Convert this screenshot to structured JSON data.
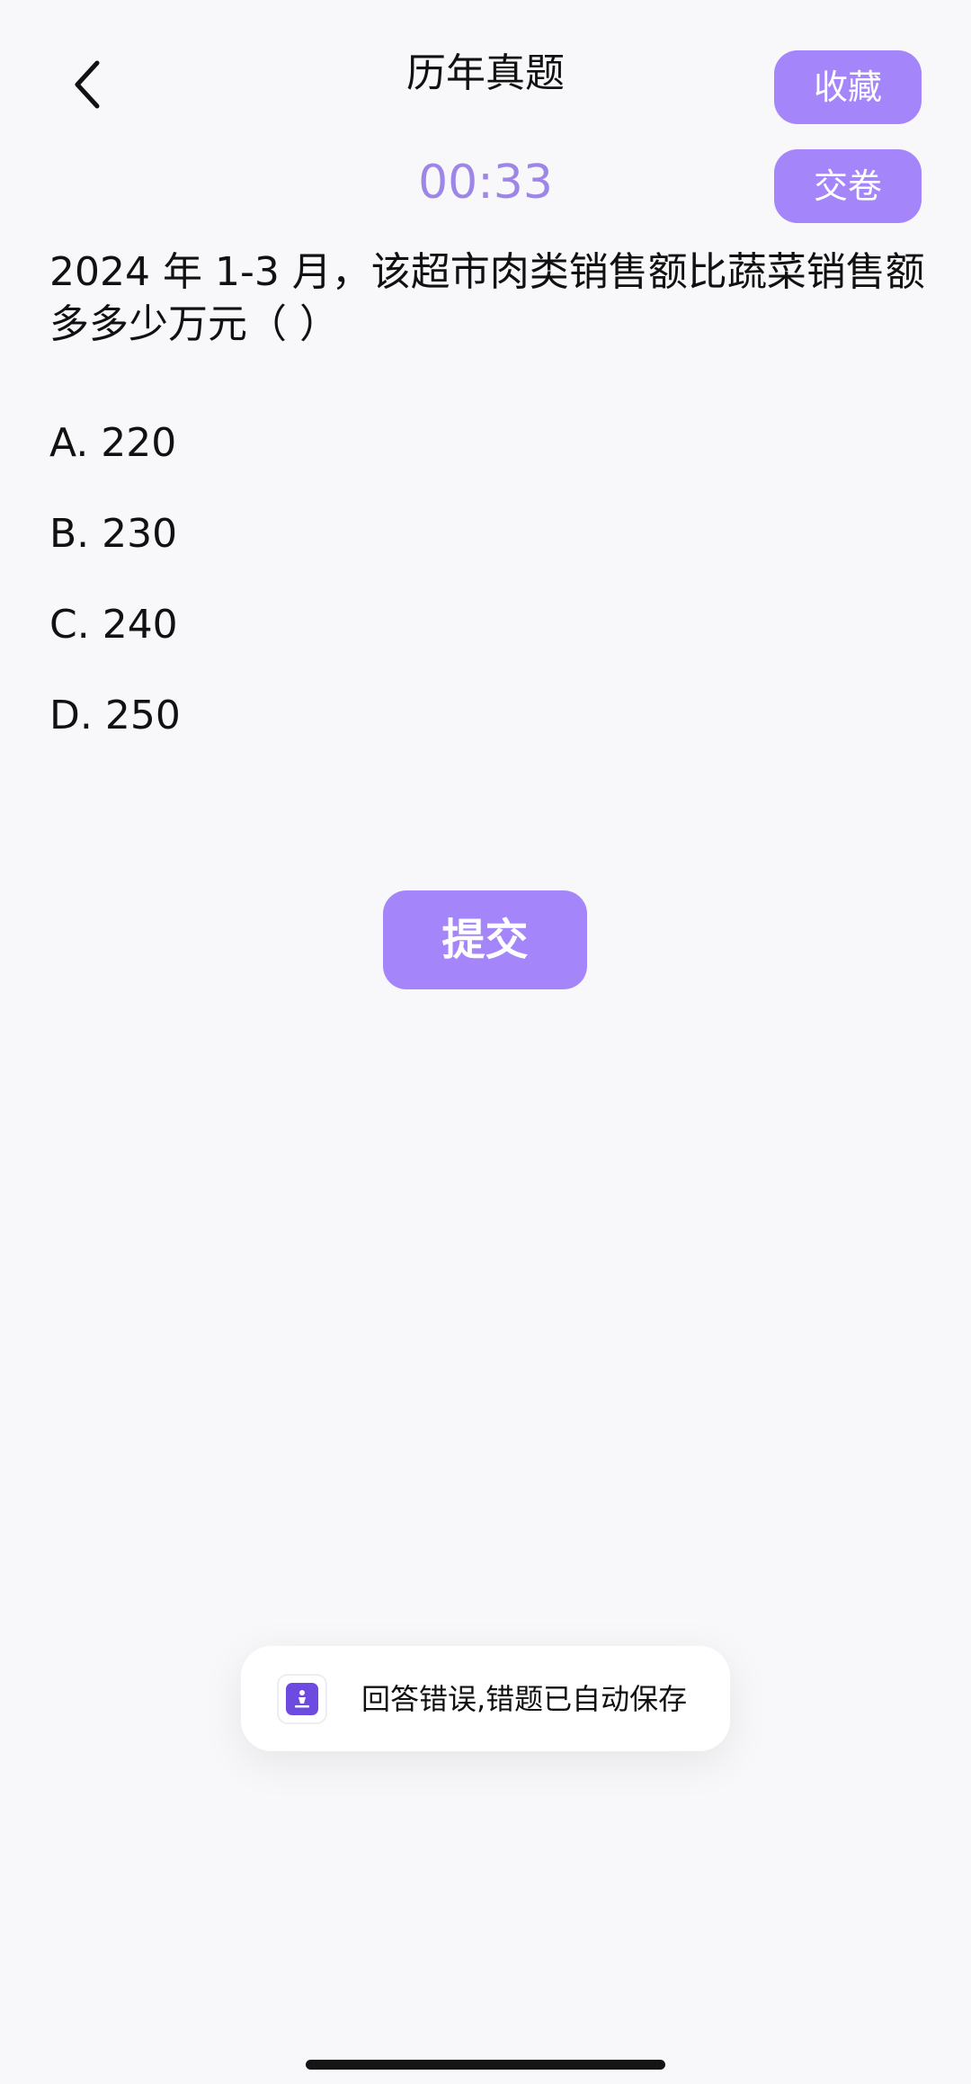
{
  "header": {
    "title": "历年真题",
    "back_icon": "chevron-left-icon",
    "favorite_label": "收藏",
    "submit_paper_label": "交卷"
  },
  "timer": {
    "value": "00:33"
  },
  "question": {
    "text": "2024 年 1-3 月，该超市肉类销售额比蔬菜销售额多多少万元（ ）",
    "options": [
      {
        "label": "A. 220"
      },
      {
        "label": "B. 230"
      },
      {
        "label": "C. 240"
      },
      {
        "label": "D. 250"
      }
    ]
  },
  "actions": {
    "submit_label": "提交"
  },
  "toast": {
    "icon": "app-logo-icon",
    "message": "回答错误,错题已自动保存"
  },
  "colors": {
    "accent": "#a485fa",
    "timer": "#9d86e8",
    "background": "#f8f8fa",
    "toast_icon": "#6d4be0"
  }
}
